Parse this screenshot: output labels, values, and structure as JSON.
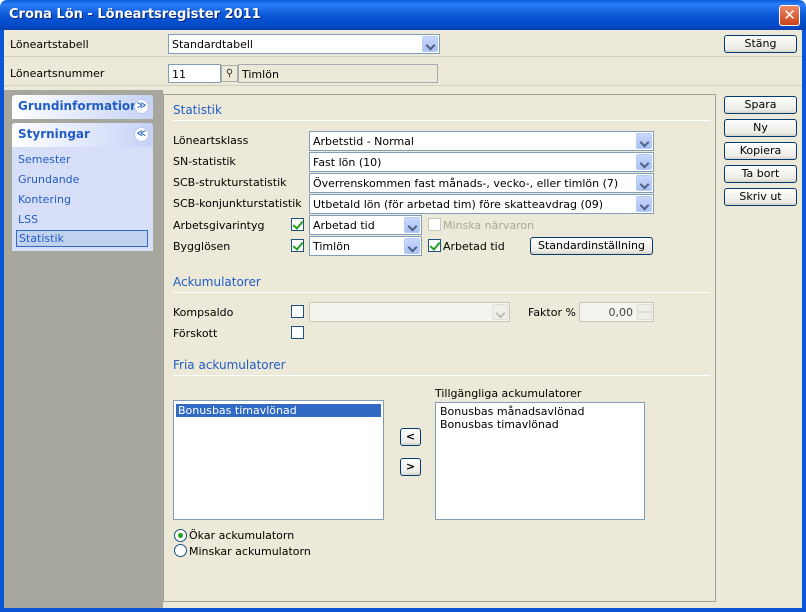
{
  "window": {
    "title": "Crona Lön - Löneartsregister 2011",
    "close_glyph": "✕"
  },
  "top": {
    "table_label": "Löneartstabell",
    "table_value": "Standardtabell",
    "number_label": "Löneartsnummer",
    "number_value": "11",
    "number_name": "Timlön",
    "close_button": "Stäng"
  },
  "nav": {
    "groups": [
      {
        "title": "Grundinformation",
        "chevron": "≫"
      },
      {
        "title": "Styrningar",
        "chevron": "≪"
      }
    ],
    "items": [
      "Semester",
      "Grundande",
      "Kontering",
      "LSS",
      "Statistik"
    ]
  },
  "statistik": {
    "heading": "Statistik",
    "rows": [
      {
        "label": "Löneartsklass",
        "value": "Arbetstid - Normal"
      },
      {
        "label": "SN-statistik",
        "value": "Fast lön (10)"
      },
      {
        "label": "SCB-strukturstatistik",
        "value": "Överrenskommen fast månads-, vecko-, eller timlön (7)"
      },
      {
        "label": "SCB-konjunkturstatistik",
        "value": "Utbetald lön (för arbetad tim) före skatteavdrag (09)"
      }
    ],
    "arbetsgivarintyg_label": "Arbetsgivarintyg",
    "arbetsgivarintyg_value": "Arbetad tid",
    "minska_label": "Minska närvaron",
    "bygglosen_label": "Bygglösen",
    "bygglosen_value": "Timlön",
    "arbetad_tid_label": "Arbetad tid",
    "standard_button": "Standardinställning"
  },
  "ackumulatorer": {
    "heading": "Ackumulatorer",
    "kompsaldo_label": "Kompsaldo",
    "faktor_label": "Faktor %",
    "faktor_value": "0,00",
    "forskott_label": "Förskott"
  },
  "fria": {
    "heading": "Fria ackumulatorer",
    "selected_items": [
      "Bonusbas timavlönad"
    ],
    "available_label": "Tillgängliga ackumulatorer",
    "available_items": [
      "Bonusbas månadsavlönad",
      "Bonusbas timavlönad"
    ],
    "move_left": "<",
    "move_right": ">",
    "radio_increase": "Ökar ackumulatorn",
    "radio_decrease": "Minskar ackumulatorn"
  },
  "actions": [
    "Spara",
    "Ny",
    "Kopiera",
    "Ta bort",
    "Skriv ut"
  ],
  "colors": {
    "title_bar": "#0a5fe0",
    "accent": "#215dc6",
    "selection": "#316ac5"
  }
}
